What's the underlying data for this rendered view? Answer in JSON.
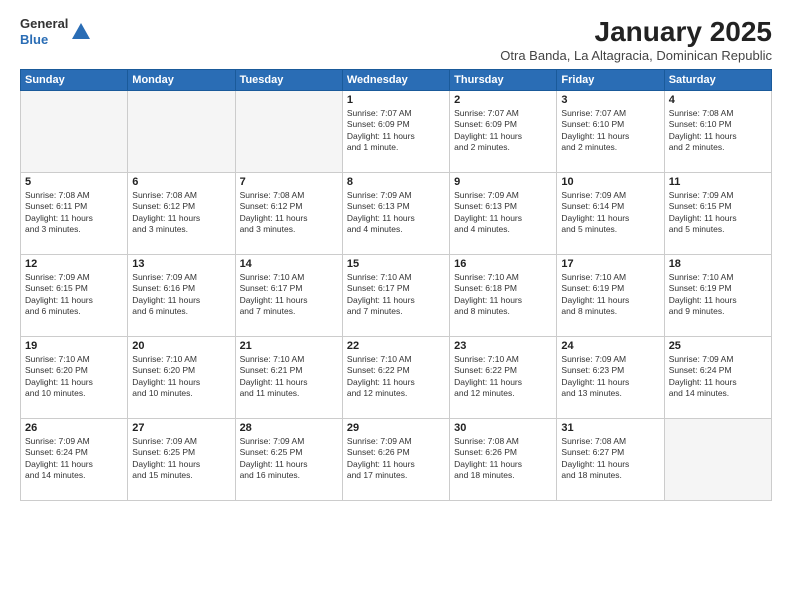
{
  "logo": {
    "general": "General",
    "blue": "Blue"
  },
  "header": {
    "month": "January 2025",
    "location": "Otra Banda, La Altagracia, Dominican Republic"
  },
  "days_of_week": [
    "Sunday",
    "Monday",
    "Tuesday",
    "Wednesday",
    "Thursday",
    "Friday",
    "Saturday"
  ],
  "weeks": [
    [
      {
        "day": "",
        "lines": []
      },
      {
        "day": "",
        "lines": []
      },
      {
        "day": "",
        "lines": []
      },
      {
        "day": "1",
        "lines": [
          "Sunrise: 7:07 AM",
          "Sunset: 6:09 PM",
          "Daylight: 11 hours",
          "and 1 minute."
        ]
      },
      {
        "day": "2",
        "lines": [
          "Sunrise: 7:07 AM",
          "Sunset: 6:09 PM",
          "Daylight: 11 hours",
          "and 2 minutes."
        ]
      },
      {
        "day": "3",
        "lines": [
          "Sunrise: 7:07 AM",
          "Sunset: 6:10 PM",
          "Daylight: 11 hours",
          "and 2 minutes."
        ]
      },
      {
        "day": "4",
        "lines": [
          "Sunrise: 7:08 AM",
          "Sunset: 6:10 PM",
          "Daylight: 11 hours",
          "and 2 minutes."
        ]
      }
    ],
    [
      {
        "day": "5",
        "lines": [
          "Sunrise: 7:08 AM",
          "Sunset: 6:11 PM",
          "Daylight: 11 hours",
          "and 3 minutes."
        ]
      },
      {
        "day": "6",
        "lines": [
          "Sunrise: 7:08 AM",
          "Sunset: 6:12 PM",
          "Daylight: 11 hours",
          "and 3 minutes."
        ]
      },
      {
        "day": "7",
        "lines": [
          "Sunrise: 7:08 AM",
          "Sunset: 6:12 PM",
          "Daylight: 11 hours",
          "and 3 minutes."
        ]
      },
      {
        "day": "8",
        "lines": [
          "Sunrise: 7:09 AM",
          "Sunset: 6:13 PM",
          "Daylight: 11 hours",
          "and 4 minutes."
        ]
      },
      {
        "day": "9",
        "lines": [
          "Sunrise: 7:09 AM",
          "Sunset: 6:13 PM",
          "Daylight: 11 hours",
          "and 4 minutes."
        ]
      },
      {
        "day": "10",
        "lines": [
          "Sunrise: 7:09 AM",
          "Sunset: 6:14 PM",
          "Daylight: 11 hours",
          "and 5 minutes."
        ]
      },
      {
        "day": "11",
        "lines": [
          "Sunrise: 7:09 AM",
          "Sunset: 6:15 PM",
          "Daylight: 11 hours",
          "and 5 minutes."
        ]
      }
    ],
    [
      {
        "day": "12",
        "lines": [
          "Sunrise: 7:09 AM",
          "Sunset: 6:15 PM",
          "Daylight: 11 hours",
          "and 6 minutes."
        ]
      },
      {
        "day": "13",
        "lines": [
          "Sunrise: 7:09 AM",
          "Sunset: 6:16 PM",
          "Daylight: 11 hours",
          "and 6 minutes."
        ]
      },
      {
        "day": "14",
        "lines": [
          "Sunrise: 7:10 AM",
          "Sunset: 6:17 PM",
          "Daylight: 11 hours",
          "and 7 minutes."
        ]
      },
      {
        "day": "15",
        "lines": [
          "Sunrise: 7:10 AM",
          "Sunset: 6:17 PM",
          "Daylight: 11 hours",
          "and 7 minutes."
        ]
      },
      {
        "day": "16",
        "lines": [
          "Sunrise: 7:10 AM",
          "Sunset: 6:18 PM",
          "Daylight: 11 hours",
          "and 8 minutes."
        ]
      },
      {
        "day": "17",
        "lines": [
          "Sunrise: 7:10 AM",
          "Sunset: 6:19 PM",
          "Daylight: 11 hours",
          "and 8 minutes."
        ]
      },
      {
        "day": "18",
        "lines": [
          "Sunrise: 7:10 AM",
          "Sunset: 6:19 PM",
          "Daylight: 11 hours",
          "and 9 minutes."
        ]
      }
    ],
    [
      {
        "day": "19",
        "lines": [
          "Sunrise: 7:10 AM",
          "Sunset: 6:20 PM",
          "Daylight: 11 hours",
          "and 10 minutes."
        ]
      },
      {
        "day": "20",
        "lines": [
          "Sunrise: 7:10 AM",
          "Sunset: 6:20 PM",
          "Daylight: 11 hours",
          "and 10 minutes."
        ]
      },
      {
        "day": "21",
        "lines": [
          "Sunrise: 7:10 AM",
          "Sunset: 6:21 PM",
          "Daylight: 11 hours",
          "and 11 minutes."
        ]
      },
      {
        "day": "22",
        "lines": [
          "Sunrise: 7:10 AM",
          "Sunset: 6:22 PM",
          "Daylight: 11 hours",
          "and 12 minutes."
        ]
      },
      {
        "day": "23",
        "lines": [
          "Sunrise: 7:10 AM",
          "Sunset: 6:22 PM",
          "Daylight: 11 hours",
          "and 12 minutes."
        ]
      },
      {
        "day": "24",
        "lines": [
          "Sunrise: 7:09 AM",
          "Sunset: 6:23 PM",
          "Daylight: 11 hours",
          "and 13 minutes."
        ]
      },
      {
        "day": "25",
        "lines": [
          "Sunrise: 7:09 AM",
          "Sunset: 6:24 PM",
          "Daylight: 11 hours",
          "and 14 minutes."
        ]
      }
    ],
    [
      {
        "day": "26",
        "lines": [
          "Sunrise: 7:09 AM",
          "Sunset: 6:24 PM",
          "Daylight: 11 hours",
          "and 14 minutes."
        ]
      },
      {
        "day": "27",
        "lines": [
          "Sunrise: 7:09 AM",
          "Sunset: 6:25 PM",
          "Daylight: 11 hours",
          "and 15 minutes."
        ]
      },
      {
        "day": "28",
        "lines": [
          "Sunrise: 7:09 AM",
          "Sunset: 6:25 PM",
          "Daylight: 11 hours",
          "and 16 minutes."
        ]
      },
      {
        "day": "29",
        "lines": [
          "Sunrise: 7:09 AM",
          "Sunset: 6:26 PM",
          "Daylight: 11 hours",
          "and 17 minutes."
        ]
      },
      {
        "day": "30",
        "lines": [
          "Sunrise: 7:08 AM",
          "Sunset: 6:26 PM",
          "Daylight: 11 hours",
          "and 18 minutes."
        ]
      },
      {
        "day": "31",
        "lines": [
          "Sunrise: 7:08 AM",
          "Sunset: 6:27 PM",
          "Daylight: 11 hours",
          "and 18 minutes."
        ]
      },
      {
        "day": "",
        "lines": []
      }
    ]
  ]
}
